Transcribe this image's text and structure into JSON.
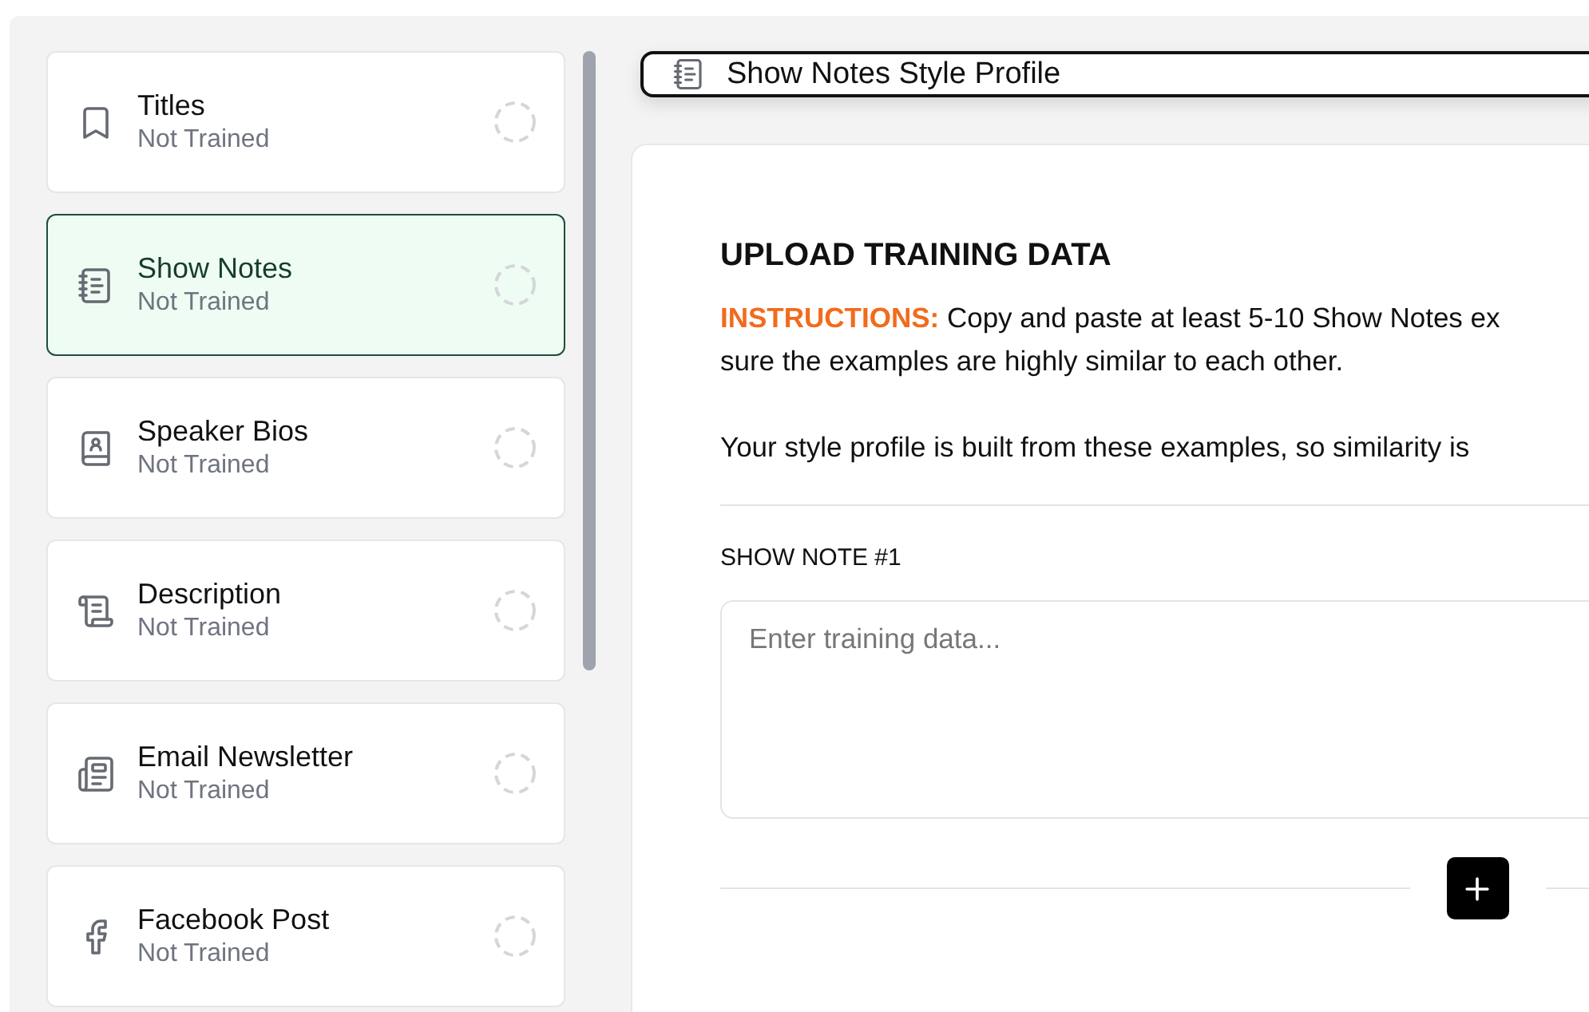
{
  "sidebar": {
    "items": [
      {
        "title": "Titles",
        "status": "Not Trained",
        "selected": false
      },
      {
        "title": "Show Notes",
        "status": "Not Trained",
        "selected": true
      },
      {
        "title": "Speaker Bios",
        "status": "Not Trained",
        "selected": false
      },
      {
        "title": "Description",
        "status": "Not Trained",
        "selected": false
      },
      {
        "title": "Email Newsletter",
        "status": "Not Trained",
        "selected": false
      },
      {
        "title": "Facebook Post",
        "status": "Not Trained",
        "selected": false
      }
    ]
  },
  "header": {
    "title": "Show Notes Style Profile"
  },
  "upload": {
    "heading": "UPLOAD TRAINING DATA",
    "instructions_label": "INSTRUCTIONS:",
    "instructions_lines": [
      "Copy and paste at least 5-10 Show Notes ex",
      "sure the examples are highly similar to each other."
    ],
    "note": "Your style profile is built from these examples, so similarity is"
  },
  "examples": [
    {
      "label": "SHOW NOTE #1",
      "placeholder": "Enter training data..."
    }
  ]
}
